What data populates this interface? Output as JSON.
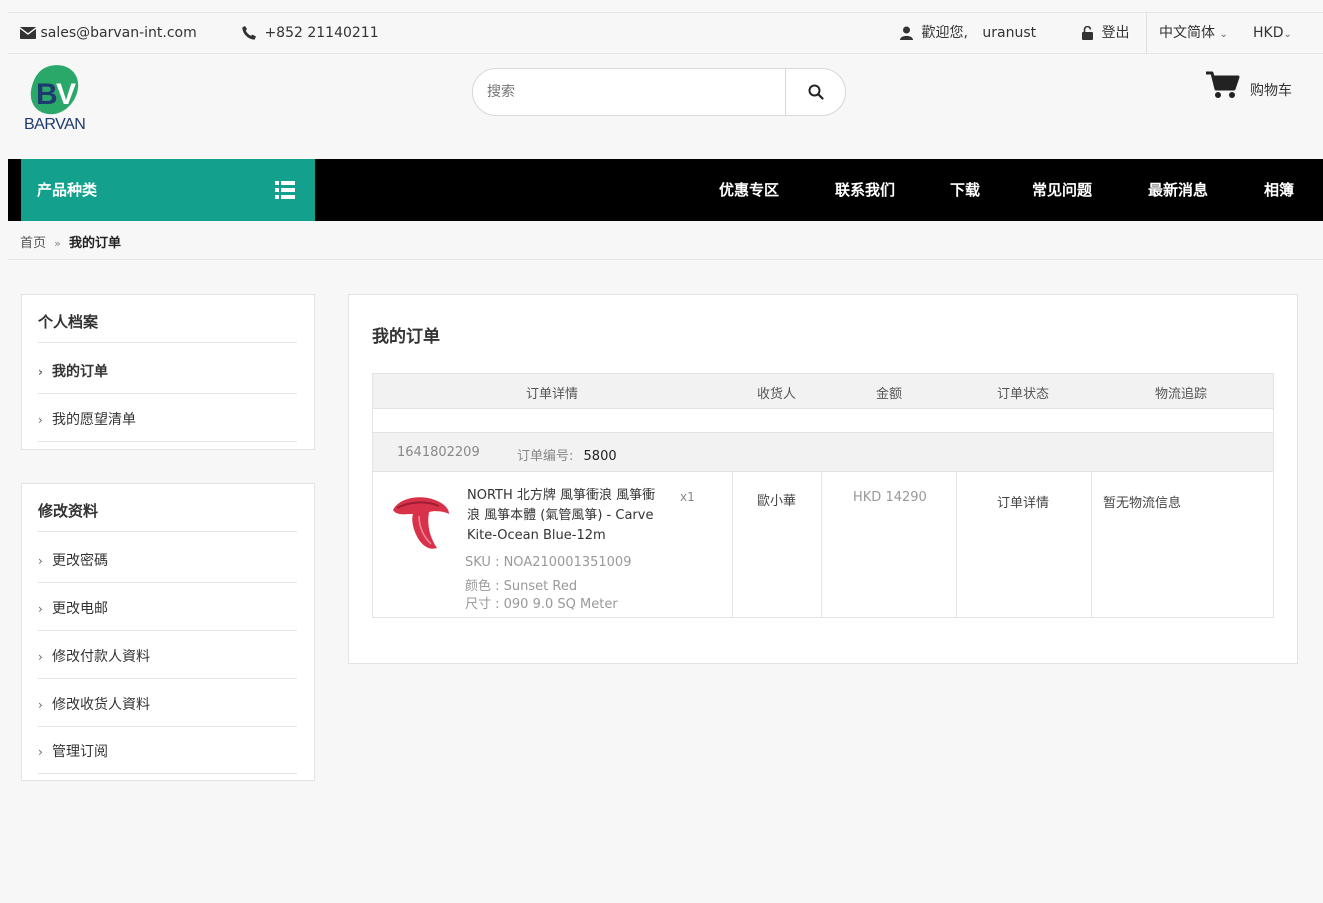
{
  "topbar": {
    "email": "sales@barvan-int.com",
    "phone": "+852 21140211",
    "welcome": "歡迎您,",
    "username": "uranust",
    "logout": "登出",
    "language": "中文简体",
    "currency": "HKD"
  },
  "header": {
    "logo_text": "BARVAN",
    "search_placeholder": "搜索",
    "cart_label": "购物车"
  },
  "nav": {
    "category_label": "产品种类",
    "items": [
      "优惠专区",
      "联系我们",
      "下载",
      "常见问题",
      "最新消息",
      "相簿"
    ]
  },
  "breadcrumb": {
    "home": "首页",
    "separator": "»",
    "current": "我的订单"
  },
  "sidebar": {
    "profile": {
      "title": "个人档案",
      "items": [
        "我的订单",
        "我的愿望清单"
      ]
    },
    "edit": {
      "title": "修改资料",
      "items": [
        "更改密碼",
        "更改电邮",
        "修改付款人資料",
        "修改收货人資料",
        "管理订阅"
      ]
    }
  },
  "main": {
    "title": "我的订单",
    "columns": [
      "订单详情",
      "收货人",
      "金额",
      "订单状态",
      "物流追踪"
    ],
    "order": {
      "date_code": "1641802209",
      "number_label": "订单编号:",
      "number": "5800",
      "product_name": "NORTH 北方牌 風箏衝浪 風箏衝浪 風箏本體 (氣管風箏) - Carve Kite-Ocean Blue-12m",
      "qty": "x1",
      "sku": "SKU : NOA210001351009",
      "color": "颜色 : Sunset Red",
      "size": "尺寸 : 090 9.0 SQ Meter",
      "receiver": "歐小華",
      "amount": "HKD 14290",
      "status": "订单详情",
      "logistics": "暂无物流信息"
    }
  },
  "colors": {
    "accent": "#13a08d",
    "nav_bg": "#000000",
    "logo_green": "#2aa86a",
    "logo_navy": "#1e3a6e",
    "product_red": "#d8324a"
  }
}
